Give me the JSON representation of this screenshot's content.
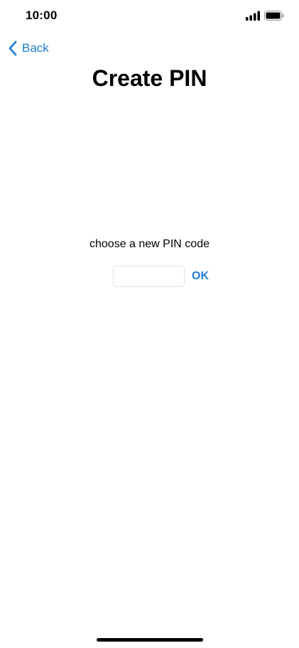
{
  "status_bar": {
    "time": "10:00",
    "icons": [
      "cellular-signal-icon",
      "battery-icon"
    ]
  },
  "nav": {
    "back_label": "Back",
    "back_icon": "chevron-left-icon"
  },
  "title": "Create PIN",
  "prompt": "choose a new PIN code",
  "pin_field": {
    "value": "",
    "placeholder": ""
  },
  "ok_label": "OK",
  "colors": {
    "accent": "#1e7ed6",
    "text": "#000000",
    "background": "#ffffff",
    "input_border": "#e3e3e6"
  }
}
